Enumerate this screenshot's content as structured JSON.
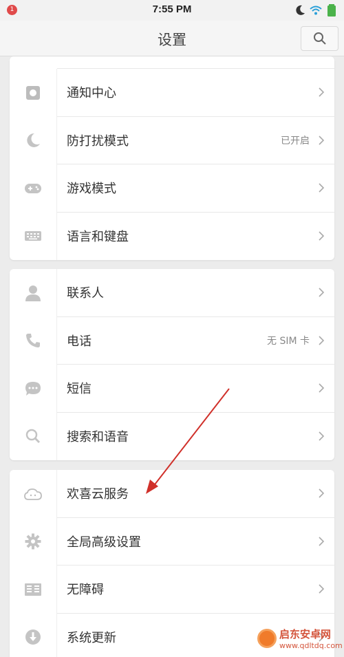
{
  "status_bar": {
    "notification_count": "1",
    "time": "7:55 PM",
    "icons": [
      "moon-icon",
      "wifi-icon",
      "battery-icon"
    ]
  },
  "header": {
    "title": "设置",
    "search_icon": "search-icon"
  },
  "groups": [
    {
      "items": [
        {
          "label": "通知中心",
          "value": "",
          "icon": "notification-icon"
        },
        {
          "label": "防打扰模式",
          "value": "已开启",
          "icon": "moon-icon"
        },
        {
          "label": "游戏模式",
          "value": "",
          "icon": "gamepad-icon"
        },
        {
          "label": "语言和键盘",
          "value": "",
          "icon": "keyboard-icon"
        }
      ]
    },
    {
      "items": [
        {
          "label": "联系人",
          "value": "",
          "icon": "person-icon"
        },
        {
          "label": "电话",
          "value": "无 SIM 卡",
          "icon": "phone-icon"
        },
        {
          "label": "短信",
          "value": "",
          "icon": "message-icon"
        },
        {
          "label": "搜索和语音",
          "value": "",
          "icon": "search-icon"
        }
      ]
    },
    {
      "items": [
        {
          "label": "欢喜云服务",
          "value": "",
          "icon": "cloud-icon"
        },
        {
          "label": "全局高级设置",
          "value": "",
          "icon": "gear-icon"
        },
        {
          "label": "无障碍",
          "value": "",
          "icon": "accessibility-icon"
        },
        {
          "label": "系统更新",
          "value": "",
          "icon": "download-icon"
        }
      ]
    }
  ],
  "watermark": {
    "name": "启东安卓网",
    "url": "www.qdltdq.com"
  },
  "colors": {
    "annotation_arrow": "#d0302a",
    "icon_gray": "#b8b8b8"
  }
}
